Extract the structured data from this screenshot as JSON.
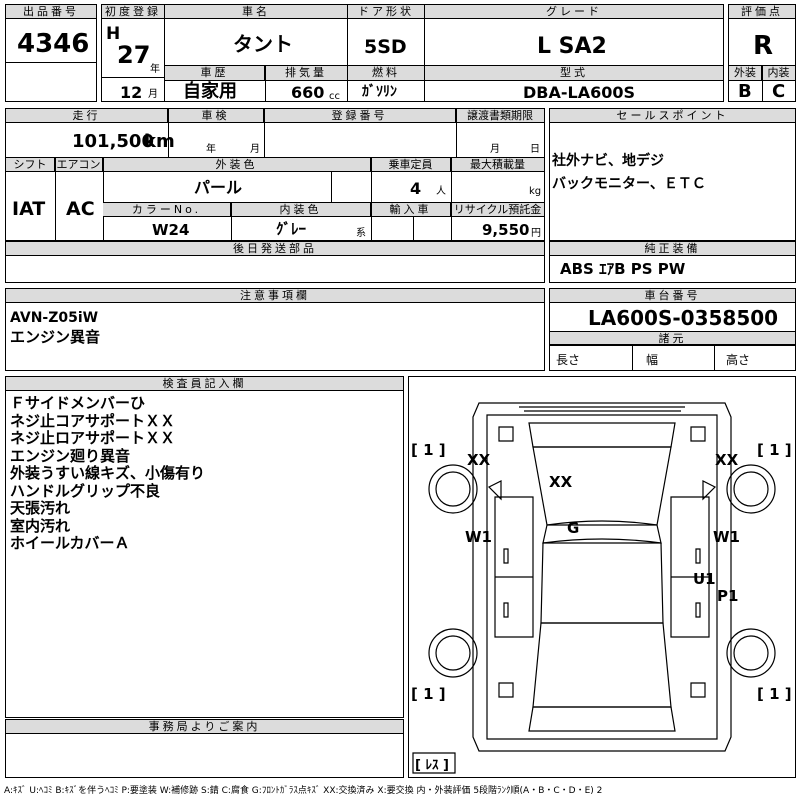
{
  "header": {
    "lot_label": "出品番号",
    "lot": "4346",
    "reg_label": "初度登録",
    "era": "H",
    "year": "27",
    "year_unit": "年",
    "month": "12",
    "month_unit": "月",
    "name_label": "車名",
    "name": "タント",
    "history_label": "車歴",
    "history": "自家用",
    "disp_label": "排気量",
    "disp": "660",
    "disp_unit": "cc",
    "door_label": "ドア形状",
    "door": "5SD",
    "fuel_label": "燃料",
    "fuel": "ｶﾞｿﾘﾝ",
    "grade_label": "グレード",
    "grade": "L SA2",
    "model_label": "型式",
    "model": "DBA-LA600S",
    "score_label": "評価点",
    "score": "R",
    "ext_label": "外装",
    "ext": "B",
    "int_label": "内装",
    "int": "C"
  },
  "row2": {
    "mileage_label": "走行",
    "mileage": "101,500",
    "mileage_unit": "km",
    "inspection_label": "車検",
    "insp_year_unit": "年",
    "insp_month_unit": "月",
    "regno_label": "登録番号",
    "transfer_label": "譲渡書類期限",
    "transfer_month_unit": "月",
    "transfer_day_unit": "日",
    "shift_label": "シフト",
    "shift": "IAT",
    "ac_label": "エアコン",
    "ac": "AC",
    "color_label": "外装色",
    "color": "パール",
    "seats_label": "乗車定員",
    "seats": "4",
    "seats_unit": "人",
    "load_label": "最大積載量",
    "load_unit": "kg",
    "colorno_label": "カラーNo.",
    "colorno": "W24",
    "intcolor_label": "内装色",
    "intcolor": "ｸﾞﾚｰ",
    "intcolor_unit": "系",
    "import_label": "輸入車",
    "recycle_label": "リサイクル預託金",
    "recycle": "9,550",
    "recycle_unit": "円"
  },
  "sales": {
    "label": "セールスポイント",
    "lines": [
      "社外ナビ、地デジ",
      "バックモニター、ＥＴＣ"
    ]
  },
  "later": {
    "label": "後日発送部品"
  },
  "equip": {
    "label": "純正装備",
    "value": "ABS ｴｱB PS PW"
  },
  "caution": {
    "label": "注意事項欄",
    "lines": [
      "AVN-Z05iW",
      "エンジン異音"
    ]
  },
  "chassis": {
    "label": "車台番号",
    "value": "LA600S-0358500",
    "spec_label": "諸元",
    "length": "長さ",
    "width": "幅",
    "height": "高さ"
  },
  "inspector": {
    "label": "検査員記入欄",
    "lines": [
      "Ｆサイドメンバーひ",
      "ネジ止コアサポートＸＸ",
      "ネジ止ロアサポートＸＸ",
      "エンジン廻り異音",
      "外装うすい線キズ、小傷有り",
      "ハンドルグリップ不良",
      "天張汚れ",
      "室内汚れ",
      "ホイールカバーＡ"
    ]
  },
  "office": {
    "label": "事務局よりご案内"
  },
  "diagram": {
    "marks": {
      "xx_left": "XX",
      "xx_center": "XX",
      "xx_right": "XX",
      "g": "G",
      "w1_left": "W1",
      "w1_right": "W1",
      "u1": "U1",
      "p1": "P1"
    },
    "tires": {
      "fl": "[ 1 ]",
      "fr": "[ 1 ]",
      "rl": "[ 1 ]",
      "rr": "[ 1 ]",
      "spare": "[ ﾚｽ ]"
    }
  },
  "legend": "A:ｷｽﾞ U:ﾍｺﾐ B:ｷｽﾞを伴うﾍｺﾐ P:要塗装 W:補修跡 S:錆 C:腐食 G:ﾌﾛﾝﾄｶﾞﾗｽ点ｷｽﾞ XX:交換済み X:要交換 内・外装評価 5段階ﾗﾝｸ順(A・B・C・D・E) 2"
}
